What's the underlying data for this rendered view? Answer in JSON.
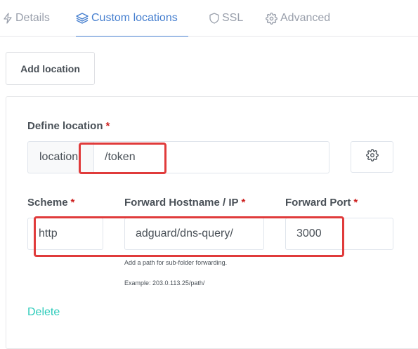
{
  "tabs": [
    {
      "label": "Details",
      "icon": "zap-icon"
    },
    {
      "label": "Custom locations",
      "icon": "layers-icon",
      "active": true
    },
    {
      "label": "SSL",
      "icon": "shield-icon"
    },
    {
      "label": "Advanced",
      "icon": "gear-icon"
    }
  ],
  "add_location_label": "Add location",
  "location": {
    "label": "Define location",
    "required_mark": "*",
    "addon": "location",
    "value": "/token"
  },
  "scheme": {
    "label": "Scheme",
    "required_mark": "*",
    "value": "http"
  },
  "hostname": {
    "label": "Forward Hostname / IP",
    "required_mark": "*",
    "value": "adguard/dns-query/",
    "hint": "Add a path for sub-folder forwarding.",
    "example": "Example: 203.0.113.25/path/"
  },
  "port": {
    "label": "Forward Port",
    "required_mark": "*",
    "value": "3000"
  },
  "delete_label": "Delete",
  "colors": {
    "accent": "#467fcf",
    "required": "#cd201f",
    "delete": "#2bcbba",
    "highlight": "#e03b3b"
  }
}
